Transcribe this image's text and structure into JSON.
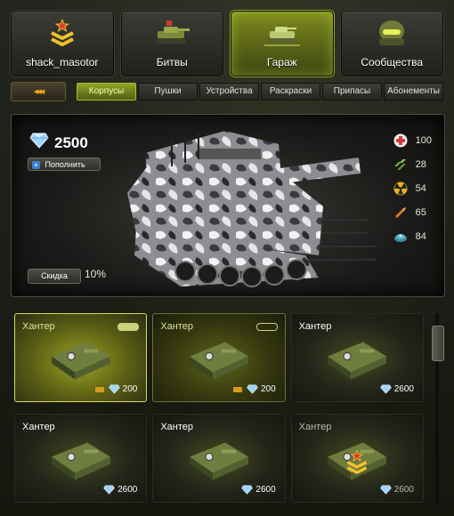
{
  "nav": [
    {
      "label": "shack_masotor",
      "icon": "rank-chevron-icon",
      "active": false
    },
    {
      "label": "Битвы",
      "icon": "battle-tank-icon",
      "active": false
    },
    {
      "label": "Гараж",
      "icon": "garage-icon",
      "active": true
    },
    {
      "label": "Сообщества",
      "icon": "helmet-icon",
      "active": false
    }
  ],
  "subnav": {
    "back_label": "◂◂◂",
    "tabs": [
      "Корпусы",
      "Пушки",
      "Устройства",
      "Раскраски",
      "Припасы",
      "Абонементы"
    ],
    "active_tab": "Корпусы"
  },
  "preview": {
    "crystals": "2500",
    "topup_label": "Пополнить",
    "discount_label": "Скидка",
    "discount_value": "10%",
    "stats": [
      {
        "icon": "health-cross-icon",
        "value": "100",
        "color": "#d83b3b"
      },
      {
        "icon": "armor-stripes-icon",
        "value": "28",
        "color": "#78b446"
      },
      {
        "icon": "nuclear-icon",
        "value": "54",
        "color": "#e8b21e"
      },
      {
        "icon": "bullet-icon",
        "value": "65",
        "color": "#d87c2a"
      },
      {
        "icon": "mine-icon",
        "value": "84",
        "color": "#5fb8c6"
      }
    ]
  },
  "items": [
    {
      "name": "Хантер",
      "price": "200",
      "state": "selected",
      "pips": "full",
      "upgrade": true
    },
    {
      "name": "Хантер",
      "price": "200",
      "state": "owned",
      "pips": "empty",
      "upgrade": true
    },
    {
      "name": "Хантер",
      "price": "2600",
      "state": "normal",
      "pips": "none",
      "upgrade": false
    },
    {
      "name": "Хантер",
      "price": "2600",
      "state": "normal",
      "pips": "none",
      "upgrade": false
    },
    {
      "name": "Хантер",
      "price": "2600",
      "state": "normal",
      "pips": "none",
      "upgrade": false
    },
    {
      "name": "Хантер",
      "price": "2600",
      "state": "locked",
      "pips": "none",
      "upgrade": false,
      "rank_badge": true
    }
  ]
}
